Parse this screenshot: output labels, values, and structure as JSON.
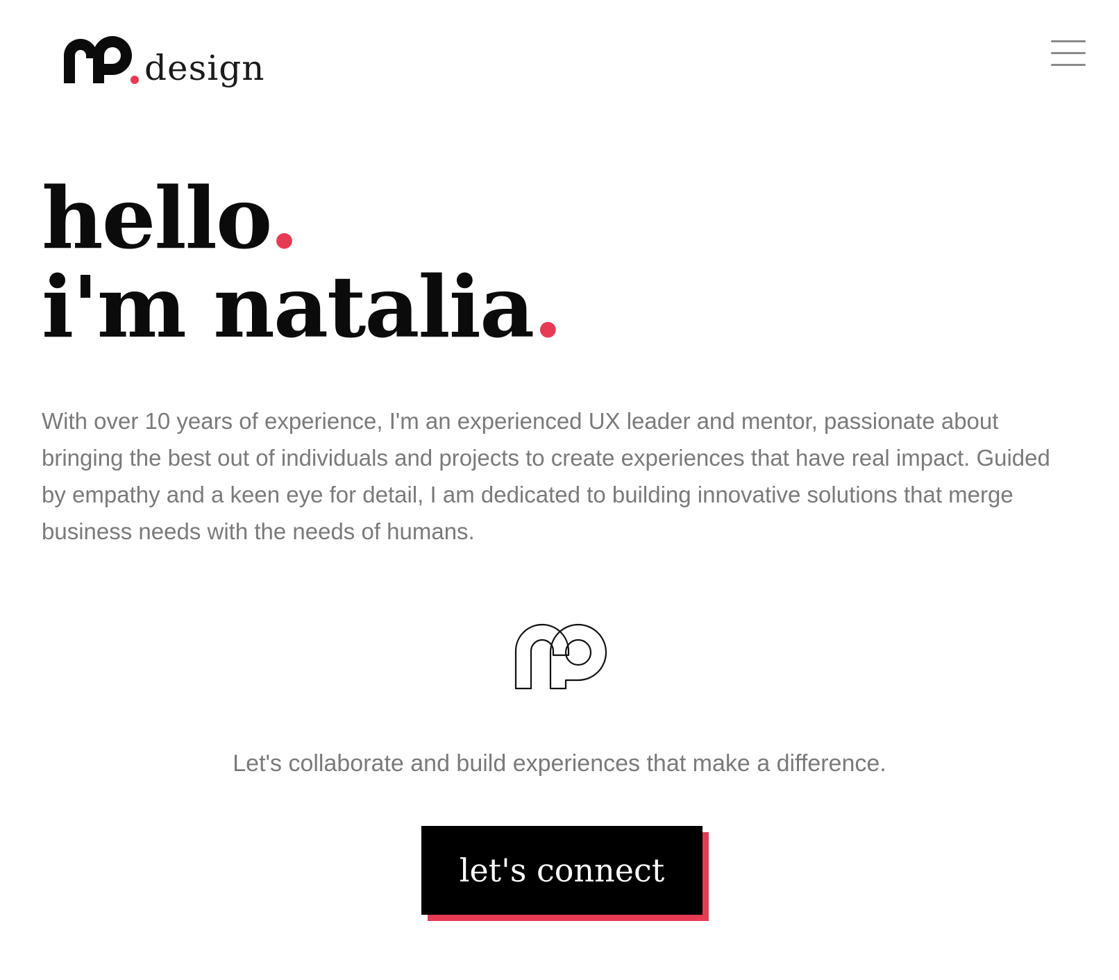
{
  "header": {
    "logo_word": "design",
    "menu_icon": "hamburger-menu-icon"
  },
  "hero": {
    "line1": "hello",
    "line2": "i'm natalia",
    "dot": "."
  },
  "intro": {
    "text": "With over 10 years of experience, I'm an experienced UX leader and mentor, passionate about bringing the best out of individuals and projects to create experiences that have real impact. Guided by empathy and a keen eye for detail, I am dedicated to building innovative solutions that merge business needs with the needs of humans."
  },
  "tagline": {
    "text": "Let's collaborate and build experiences that make a difference."
  },
  "cta": {
    "label": "let's connect"
  },
  "colors": {
    "accent": "#e73a55",
    "text_dark": "#0b0b0b",
    "text_muted": "#7a7a7a",
    "button_bg": "#000000",
    "background": "#ffffff"
  }
}
